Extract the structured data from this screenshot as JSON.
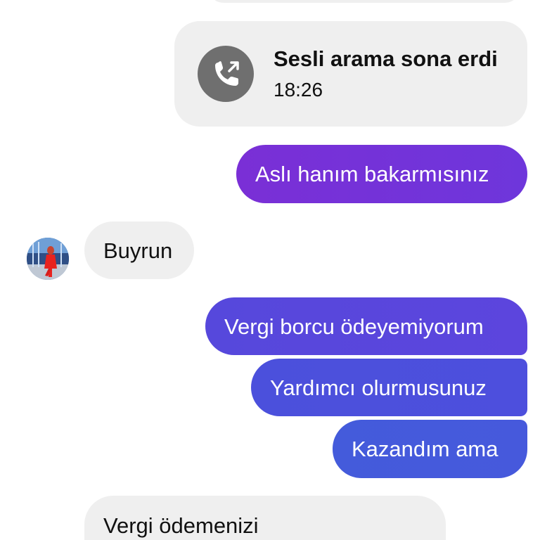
{
  "colors": {
    "incoming_bubble": "#efefef",
    "outgoing_purple": "#7a2fd6",
    "outgoing_indigo": "#5648dc",
    "outgoing_blue": "#445bdb",
    "call_icon_bg": "#6f6f6f"
  },
  "call_event": {
    "icon": "phone-outgoing-icon",
    "title": "Sesli arama sona erdi",
    "time": "18:26"
  },
  "messages": [
    {
      "direction": "outgoing",
      "text": "Aslı hanım bakarmısınız"
    },
    {
      "direction": "incoming",
      "text": "Buyrun"
    },
    {
      "direction": "outgoing",
      "text": "Vergi borcu ödeyemiyorum"
    },
    {
      "direction": "outgoing",
      "text": "Yardımcı olurmusunuz"
    },
    {
      "direction": "outgoing",
      "text": "Kazandım ama"
    },
    {
      "direction": "incoming",
      "text": "Vergi ödemenizi"
    }
  ],
  "contact": {
    "avatar": "contact-avatar"
  }
}
